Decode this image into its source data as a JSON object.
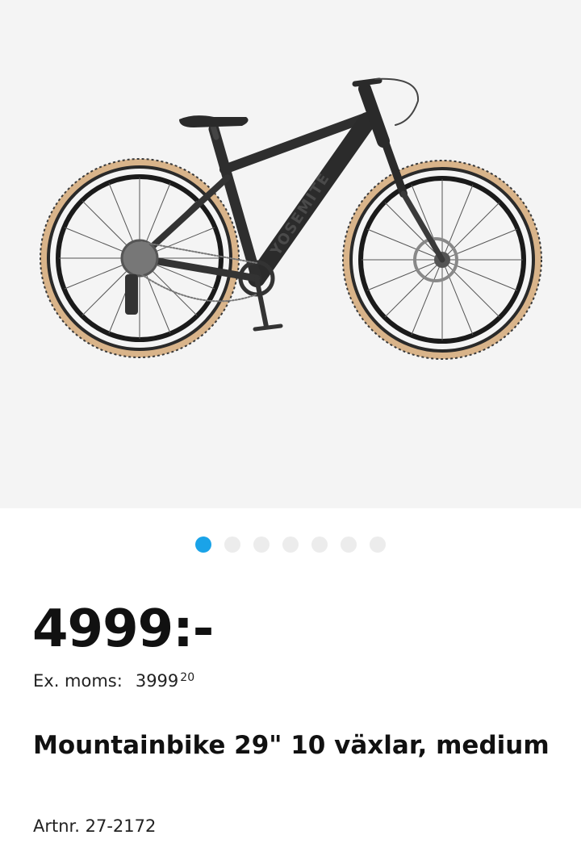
{
  "product": {
    "image_icon": "mountain-bike-image",
    "frame_brand_text": "YOSEMITE",
    "gallery": {
      "count": 7,
      "active_index": 0,
      "active_color": "#1aa3e8",
      "inactive_color": "#ececec"
    },
    "price": "4999:-",
    "ex_vat": {
      "label": "Ex. moms:",
      "amount": "3999",
      "decimals": "20"
    },
    "title": "Mountainbike 29\" 10 växlar, medium",
    "article_number": "Artnr. 27-2172"
  }
}
